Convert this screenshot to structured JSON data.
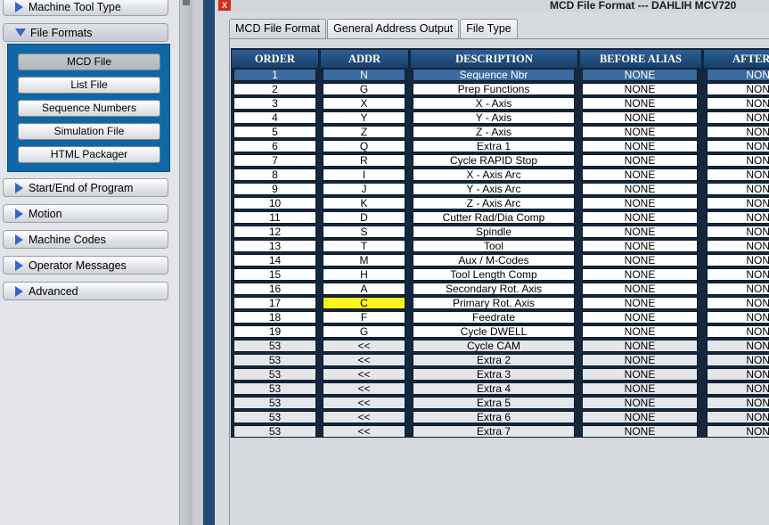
{
  "nav": {
    "machine_tool_type": "Machine Tool Type",
    "file_formats": "File Formats",
    "sub_items": [
      "MCD File",
      "List File",
      "Sequence Numbers",
      "Simulation File",
      "HTML Packager"
    ],
    "start_end": "Start/End of Program",
    "motion": "Motion",
    "machine_codes": "Machine Codes",
    "operator_messages": "Operator Messages",
    "advanced": "Advanced"
  },
  "window": {
    "icon_text": "X",
    "title": "MCD File Format --- DAHLIH MCV720"
  },
  "tabs": [
    "MCD File Format",
    "General Address Output",
    "File Type"
  ],
  "table": {
    "headers": [
      "ORDER",
      "ADDR",
      "DESCRIPTION",
      "BEFORE ALIAS",
      "AFTER"
    ],
    "rows": [
      {
        "order": "1",
        "addr": "N",
        "desc": "Sequence Nbr",
        "before": "NONE",
        "after": "NONE"
      },
      {
        "order": "2",
        "addr": "G",
        "desc": "Prep Functions",
        "before": "NONE",
        "after": "NONE"
      },
      {
        "order": "3",
        "addr": "X",
        "desc": "X - Axis",
        "before": "NONE",
        "after": "NONE"
      },
      {
        "order": "4",
        "addr": "Y",
        "desc": "Y - Axis",
        "before": "NONE",
        "after": "NONE"
      },
      {
        "order": "5",
        "addr": "Z",
        "desc": "Z - Axis",
        "before": "NONE",
        "after": "NONE"
      },
      {
        "order": "6",
        "addr": "Q",
        "desc": "Extra 1",
        "before": "NONE",
        "after": "NONE"
      },
      {
        "order": "7",
        "addr": "R",
        "desc": "Cycle RAPID Stop",
        "before": "NONE",
        "after": "NONE"
      },
      {
        "order": "8",
        "addr": "I",
        "desc": "X - Axis Arc",
        "before": "NONE",
        "after": "NONE"
      },
      {
        "order": "9",
        "addr": "J",
        "desc": "Y - Axis Arc",
        "before": "NONE",
        "after": "NONE"
      },
      {
        "order": "10",
        "addr": "K",
        "desc": "Z - Axis Arc",
        "before": "NONE",
        "after": "NONE"
      },
      {
        "order": "11",
        "addr": "D",
        "desc": "Cutter Rad/Dia Comp",
        "before": "NONE",
        "after": "NONE"
      },
      {
        "order": "12",
        "addr": "S",
        "desc": "Spindle",
        "before": "NONE",
        "after": "NONE"
      },
      {
        "order": "13",
        "addr": "T",
        "desc": "Tool",
        "before": "NONE",
        "after": "NONE"
      },
      {
        "order": "14",
        "addr": "M",
        "desc": "Aux / M-Codes",
        "before": "NONE",
        "after": "NONE"
      },
      {
        "order": "15",
        "addr": "H",
        "desc": "Tool Length Comp",
        "before": "NONE",
        "after": "NONE"
      },
      {
        "order": "16",
        "addr": "A",
        "desc": "Secondary Rot. Axis",
        "before": "NONE",
        "after": "NONE"
      },
      {
        "order": "17",
        "addr": "C",
        "desc": "Primary Rot. Axis",
        "before": "NONE",
        "after": "NONE"
      },
      {
        "order": "18",
        "addr": "F",
        "desc": "Feedrate",
        "before": "NONE",
        "after": "NONE"
      },
      {
        "order": "19",
        "addr": "G",
        "desc": "Cycle DWELL",
        "before": "NONE",
        "after": "NONE"
      },
      {
        "order": "53",
        "addr": "<<",
        "desc": "Cycle CAM",
        "before": "NONE",
        "after": "NONE"
      },
      {
        "order": "53",
        "addr": "<<",
        "desc": "Extra 2",
        "before": "NONE",
        "after": "NONE"
      },
      {
        "order": "53",
        "addr": "<<",
        "desc": "Extra 3",
        "before": "NONE",
        "after": "NONE"
      },
      {
        "order": "53",
        "addr": "<<",
        "desc": "Extra 4",
        "before": "NONE",
        "after": "NONE"
      },
      {
        "order": "53",
        "addr": "<<",
        "desc": "Extra 5",
        "before": "NONE",
        "after": "NONE"
      },
      {
        "order": "53",
        "addr": "<<",
        "desc": "Extra 6",
        "before": "NONE",
        "after": "NONE"
      },
      {
        "order": "53",
        "addr": "<<",
        "desc": "Extra 7",
        "before": "NONE",
        "after": "NONE"
      }
    ],
    "selected_row": 0,
    "highlighted_addr_row": 16,
    "inactive_rows_from": 19
  },
  "colors": {
    "header_bg": "#1f4f82",
    "selected_row": "#3a6a9f",
    "highlight": "#f7f51a",
    "sub_panel": "#0f67a6"
  }
}
